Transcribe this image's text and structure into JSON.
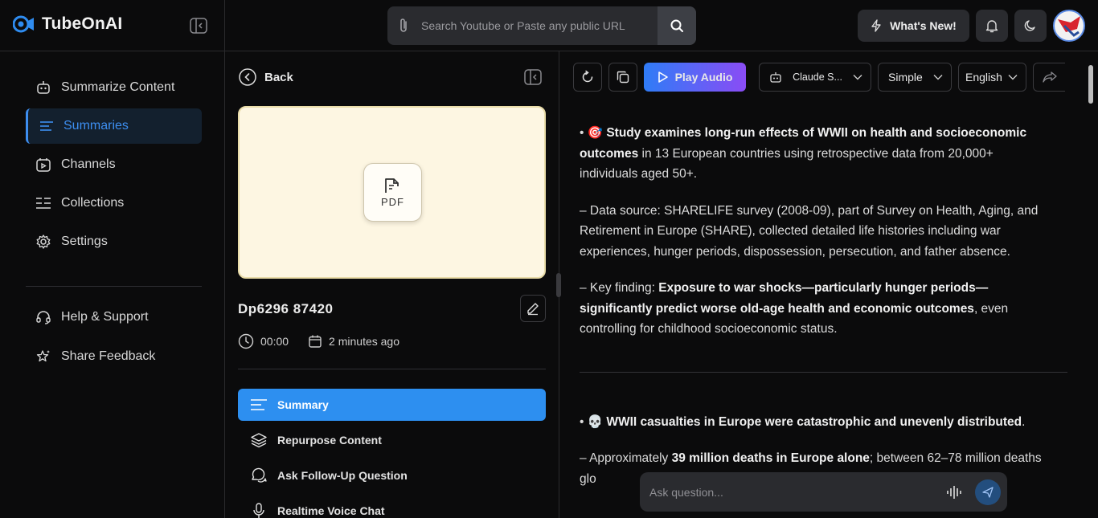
{
  "header": {
    "brand": "TubeOnAI",
    "search_placeholder": "Search Youtube or Paste any public URL",
    "whats_new": "What's New!"
  },
  "sidebar": {
    "items": [
      {
        "label": "Summarize Content",
        "icon": "robot-icon"
      },
      {
        "label": "Summaries",
        "icon": "list-lines-icon",
        "active": true
      },
      {
        "label": "Channels",
        "icon": "calendar-tv-icon"
      },
      {
        "label": "Collections",
        "icon": "collection-list-icon"
      },
      {
        "label": "Settings",
        "icon": "gear-icon"
      }
    ],
    "bottom": [
      {
        "label": "Help & Support",
        "icon": "headset-icon"
      },
      {
        "label": "Share Feedback",
        "icon": "star-sparkle-icon"
      }
    ]
  },
  "detail": {
    "back": "Back",
    "thumb_label": "PDF",
    "title": "Dp6296 87420",
    "duration": "00:00",
    "time_ago": "2 minutes ago",
    "menu": [
      {
        "label": "Summary",
        "icon": "summary-lines-icon",
        "active": true
      },
      {
        "label": "Repurpose Content",
        "icon": "layers-icon"
      },
      {
        "label": "Ask Follow-Up Question",
        "icon": "chat-bubbles-icon"
      },
      {
        "label": "Realtime Voice Chat",
        "icon": "microphone-icon"
      }
    ]
  },
  "toolbar": {
    "play_audio": "Play Audio",
    "model": "Claude S...",
    "style": "Simple",
    "language": "English"
  },
  "summary": {
    "p1_bullet": "• 🎯 ",
    "p1_bold": "Study examines long-run effects of WWII on health and socioeconomic outcomes",
    "p1_rest": " in 13 European countries using retrospective data from 20,000+ individuals aged 50+.",
    "p2": "– Data source: SHARELIFE survey (2008-09), part of Survey on Health, Aging, and Retirement in Europe (SHARE), collected detailed life histories including war experiences, hunger periods, dispossession, persecution, and father absence.",
    "p3_pre": "– Key finding: ",
    "p3_bold": "Exposure to war shocks—particularly hunger periods—significantly predict worse old-age health and economic outcomes",
    "p3_rest": ", even controlling for childhood socioeconomic status.",
    "p4_bullet": "• 💀 ",
    "p4_bold": "WWII casualties in Europe were catastrophic and unevenly distributed",
    "p4_rest": ".",
    "p5_pre": "– Approximately ",
    "p5_bold": "39 million deaths in Europe alone",
    "p5_rest": "; between 62–78 million deaths glo"
  },
  "ask": {
    "placeholder": "Ask question..."
  },
  "colors": {
    "accent": "#2d8ff0",
    "active_nav_bg": "#13202e",
    "play_gradient_start": "#2f7cf6",
    "play_gradient_end": "#8a4cf5",
    "thumb_bg": "#fdf6e2"
  }
}
